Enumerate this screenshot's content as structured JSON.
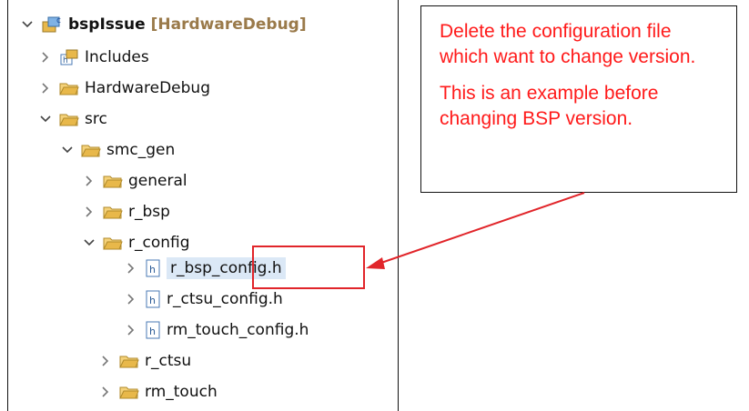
{
  "tree": {
    "project": {
      "name": "bspIssue",
      "suffix": "[HardwareDebug]"
    },
    "items": [
      {
        "label": "Includes"
      },
      {
        "label": "HardwareDebug"
      },
      {
        "label": "src"
      },
      {
        "label": "smc_gen"
      },
      {
        "label": "general"
      },
      {
        "label": "r_bsp"
      },
      {
        "label": "r_config"
      },
      {
        "label": "r_bsp_config.h"
      },
      {
        "label": "r_ctsu_config.h"
      },
      {
        "label": "rm_touch_config.h"
      },
      {
        "label": "r_ctsu"
      },
      {
        "label": "rm_touch"
      }
    ]
  },
  "callout": {
    "line1": "Delete the configuration file which want to change version.",
    "line2": "This is an example before changing BSP version."
  },
  "colors": {
    "annotation": "#ff1a1a",
    "selection": "#dbe8f6",
    "folder": "#e8b84a"
  }
}
